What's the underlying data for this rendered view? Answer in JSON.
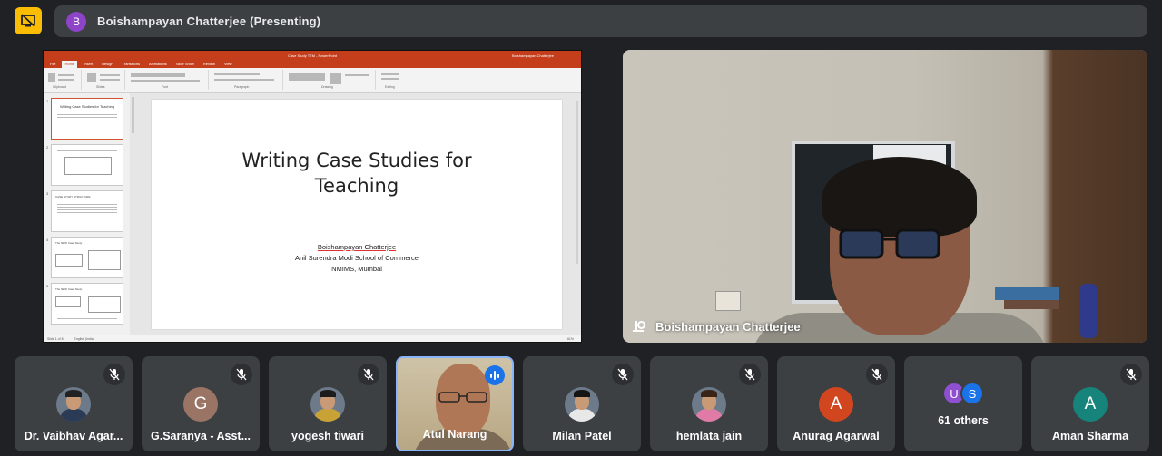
{
  "presenting": {
    "avatar_letter": "B",
    "label": "Boishampayan Chatterjee (Presenting)"
  },
  "shared_screen": {
    "app_title": "Case Study TTM - PowerPoint",
    "tabs": [
      "File",
      "Home",
      "Insert",
      "Design",
      "Transitions",
      "Animations",
      "Slide Show",
      "Review",
      "View"
    ],
    "active_tab": "Home",
    "ribbon_groups": [
      "Clipboard",
      "Slides",
      "Font",
      "Paragraph",
      "Drawing",
      "Editing"
    ],
    "user": "Boishampayan Chatterjee",
    "slide": {
      "title_line1": "Writing Case Studies for",
      "title_line2": "Teaching",
      "author": "Boishampayan Chatterjee",
      "school": "Anil Surendra Modi School of Commerce",
      "location": "NMIMS, Mumbai"
    },
    "thumbnails": [
      {
        "num": "1",
        "title": "Writing Case Studies for Teaching"
      },
      {
        "num": "2",
        "title": ""
      },
      {
        "num": "3",
        "title": "CASE STUDY STRUCTURE"
      },
      {
        "num": "4",
        "title": "The NEW Case Study"
      },
      {
        "num": "5",
        "title": "The NEW Case Study"
      }
    ],
    "status_slide": "Slide 1 of 8",
    "status_lang": "English (India)",
    "status_zoom": "61%"
  },
  "camera": {
    "name": "Boishampayan Chatterjee"
  },
  "participants": [
    {
      "name": "Dr. Vaibhav Agar...",
      "type": "photo",
      "muted": true,
      "hair": "#222",
      "shirt": "#2b3a55"
    },
    {
      "name": "G.Saranya - Asst...",
      "type": "letter",
      "letter": "G",
      "color": "#9a7566",
      "muted": true
    },
    {
      "name": "yogesh tiwari",
      "type": "photo",
      "muted": true,
      "hair": "#1c1c1c",
      "shirt": "#c9a235"
    },
    {
      "name": "Atul Narang",
      "type": "video",
      "muted": false,
      "speaking": true
    },
    {
      "name": "Milan Patel",
      "type": "photo",
      "muted": true,
      "hair": "#151515",
      "shirt": "#e8e8e8"
    },
    {
      "name": "hemlata jain",
      "type": "photo",
      "muted": true,
      "hair": "#3a2418",
      "shirt": "#e07aa6"
    },
    {
      "name": "Anurag Agarwal",
      "type": "letter",
      "letter": "A",
      "color": "#d1461f",
      "muted": true
    },
    {
      "name": "others",
      "type": "others",
      "letters": [
        "U",
        "S"
      ],
      "colors": [
        "#8e4fd1",
        "#1a73e8"
      ],
      "count_label": "61 others",
      "muted": false
    },
    {
      "name": "Aman Sharma",
      "type": "letter",
      "letter": "A",
      "color": "#16847b",
      "muted": true
    }
  ],
  "icons": {
    "present": "present-stop-icon",
    "mic_off": "mic-off-icon",
    "speaking": "speaking-indicator-icon",
    "pin": "pin-icon"
  },
  "colors": {
    "background": "#202124",
    "surface": "#3c4043",
    "accent_yellow": "#fbbc04",
    "speaking_border": "#8ab4f8",
    "powerpoint": "#c43e1c"
  }
}
